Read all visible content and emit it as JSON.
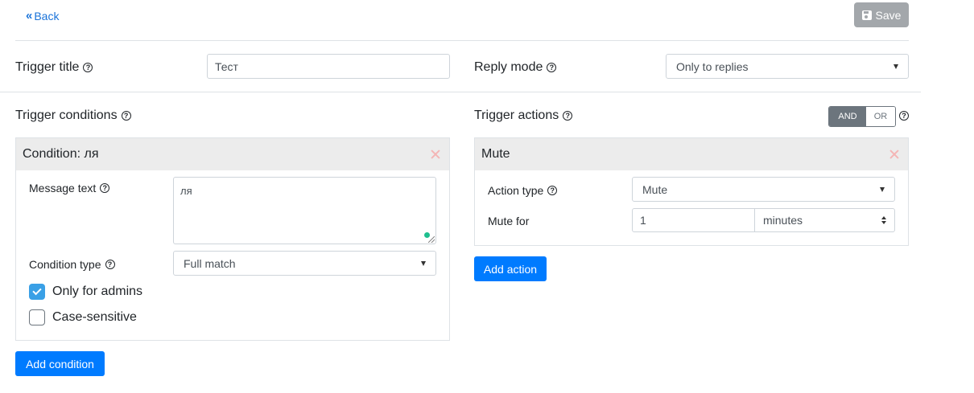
{
  "header": {
    "back_label": "Back",
    "save_label": "Save"
  },
  "trigger_title": {
    "label": "Trigger title",
    "value": "Тест"
  },
  "reply_mode": {
    "label": "Reply mode",
    "value": "Only to replies"
  },
  "conditions": {
    "label": "Trigger conditions",
    "card_title": "Condition: ля",
    "message_text_label": "Message text",
    "message_text_value": "ля",
    "condition_type_label": "Condition type",
    "condition_type_value": "Full match",
    "only_admins_label": "Only for admins",
    "only_admins_checked": true,
    "case_sensitive_label": "Case-sensitive",
    "case_sensitive_checked": false,
    "add_button": "Add condition"
  },
  "actions": {
    "label": "Trigger actions",
    "logic": {
      "and_label": "AND",
      "or_label": "OR",
      "selected": "AND"
    },
    "card_title": "Mute",
    "action_type_label": "Action type",
    "action_type_value": "Mute",
    "mute_for_label": "Mute for",
    "mute_for_value": "1",
    "mute_unit_value": "minutes",
    "add_button": "Add action"
  },
  "colors": {
    "primary": "#007bff",
    "link": "#1a73d9",
    "save_disabled": "#a3a7ab",
    "checkbox_checked": "#3aa0e6",
    "toggle_active": "#6c757d"
  }
}
